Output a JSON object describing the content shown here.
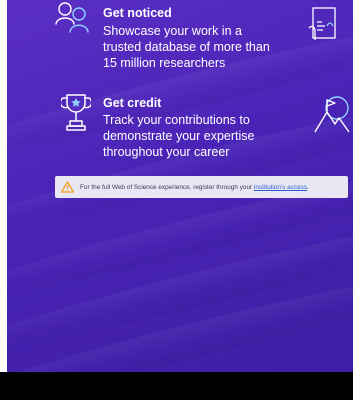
{
  "features": [
    {
      "title": "Get noticed",
      "description": "Showcase your work in a trusted database of more than 15 million researchers",
      "icon": "people-icon",
      "side_icon": "framed-certificate-icon"
    },
    {
      "title": "Get credit",
      "description": "Track your contributions to demonstrate your expertise throughout your career",
      "icon": "trophy-icon",
      "side_icon": "mountain-flag-icon"
    }
  ],
  "notice": {
    "icon": "warning-icon",
    "text": "For the full Web of Science experience, register through your",
    "link_text": "institution's access",
    "end": "."
  },
  "colors": {
    "panel_background": "#4a23b6",
    "notice_background": "#e9e7f4",
    "link": "#2a5fd6",
    "warning": "#f0a020"
  }
}
